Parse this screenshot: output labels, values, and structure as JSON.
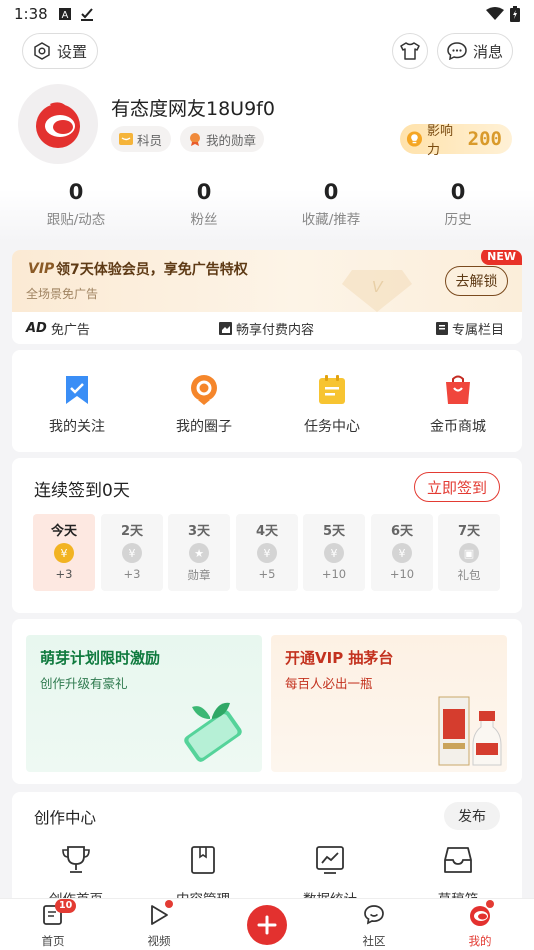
{
  "status_bar": {
    "time": "1:38"
  },
  "header": {
    "settings_label": "设置",
    "messages_label": "消息"
  },
  "profile": {
    "username": "有态度网友18U9f0",
    "tag_member": "科员",
    "tag_medal": "我的勋章",
    "influence_label": "影响力",
    "influence_value": "200"
  },
  "stats": [
    {
      "value": "0",
      "label": "跟贴/动态"
    },
    {
      "value": "0",
      "label": "粉丝"
    },
    {
      "value": "0",
      "label": "收藏/推荐"
    },
    {
      "value": "0",
      "label": "历史"
    }
  ],
  "vip": {
    "logo": "VIP",
    "title": "领7天体验会员，享免广告特权",
    "subtitle": "全场景免广告",
    "unlock_label": "去解锁",
    "new_badge": "NEW",
    "perks": [
      {
        "icon_text": "AD",
        "label": "免广告"
      },
      {
        "label": "畅享付费内容"
      },
      {
        "label": "专属栏目"
      }
    ]
  },
  "quick_links": [
    {
      "label": "我的关注",
      "icon": "bookmark-icon",
      "color": "#3a8ef6"
    },
    {
      "label": "我的圈子",
      "icon": "circle-icon",
      "color": "#f5862b"
    },
    {
      "label": "任务中心",
      "icon": "task-icon",
      "color": "#f7c431"
    },
    {
      "label": "金币商城",
      "icon": "shop-bag-icon",
      "color": "#f0463c"
    }
  ],
  "checkin": {
    "title": "连续签到0天",
    "button": "立即签到",
    "days": [
      {
        "label": "今天",
        "reward": "+3"
      },
      {
        "label": "2天",
        "reward": "+3"
      },
      {
        "label": "3天",
        "reward": "勋章"
      },
      {
        "label": "4天",
        "reward": "+5"
      },
      {
        "label": "5天",
        "reward": "+10"
      },
      {
        "label": "6天",
        "reward": "+10"
      },
      {
        "label": "7天",
        "reward": "礼包"
      }
    ]
  },
  "promos": {
    "left": {
      "title": "萌芽计划限时激励",
      "subtitle": "创作升级有豪礼"
    },
    "right": {
      "title": "开通VIP 抽茅台",
      "subtitle": "每百人必出一瓶"
    }
  },
  "creation": {
    "title": "创作中心",
    "publish": "发布",
    "items": [
      {
        "label": "创作首页",
        "icon": "trophy-icon"
      },
      {
        "label": "内容管理",
        "icon": "content-icon"
      },
      {
        "label": "数据统计",
        "icon": "chart-icon"
      },
      {
        "label": "草稿箱",
        "icon": "drafts-icon"
      }
    ]
  },
  "tabbar": {
    "home": "首页",
    "home_badge": "10",
    "video": "视频",
    "community": "社区",
    "mine": "我的"
  },
  "colors": {
    "accent": "#e3312f"
  }
}
